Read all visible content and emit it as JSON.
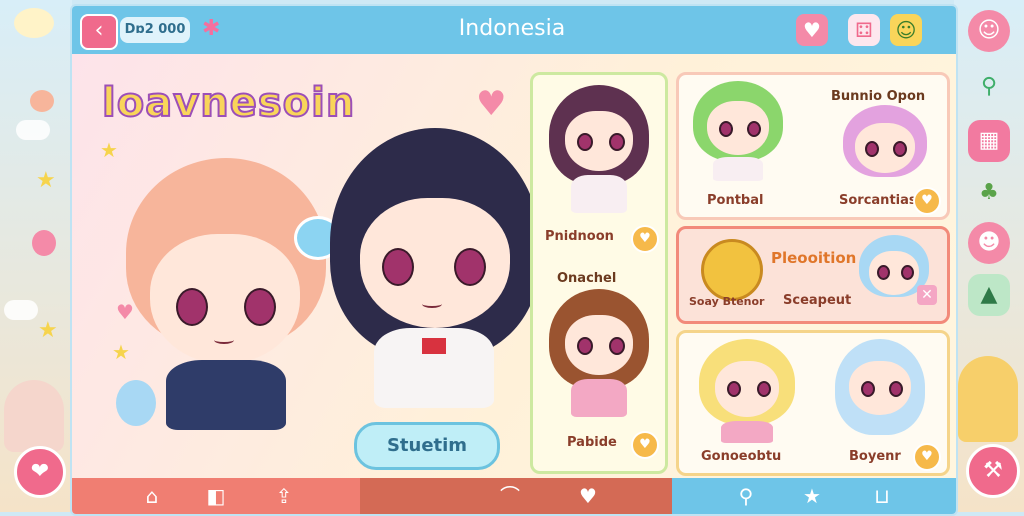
{
  "header": {
    "code_label": "Dɒ2 000",
    "title": "Indonesia"
  },
  "hero": {
    "logo_title": "loavnesoin",
    "start_button": "Stuetim"
  },
  "middle_cards": [
    {
      "label": "Pnidnoon"
    },
    {
      "label": "Pabide",
      "header": "Onachel"
    }
  ],
  "right_cards": {
    "top": {
      "header": "Bunnio Opon",
      "left_label": "Pontbal",
      "right_label": "Sorcantias"
    },
    "middle": {
      "header": "Pleooition",
      "left_label": "Soay Btenor",
      "right_label": "Sceapeut"
    },
    "bottom": {
      "left_label": "Gonoeobtu",
      "right_label": "Boyenr"
    }
  },
  "icons": {
    "back": "back-arrow-icon",
    "top_right": [
      "heart-icon",
      "dice-icon",
      "emoji-icon"
    ],
    "side_right": [
      "face-icon",
      "pin-icon",
      "grid-icon",
      "tree-icon",
      "mascot-icon",
      "ghost-icon"
    ],
    "bottom": [
      "home-icon",
      "ticket-icon",
      "share-icon",
      "hat-icon",
      "heart-icon",
      "search-icon",
      "star-icon",
      "cup-icon"
    ]
  },
  "colors": {
    "topbar": "#6ec5e8",
    "accent_pink": "#f06a8c",
    "bottom_left": "#f07e72",
    "bottom_mid": "#d46a55",
    "bottom_right": "#6ec5e8"
  }
}
